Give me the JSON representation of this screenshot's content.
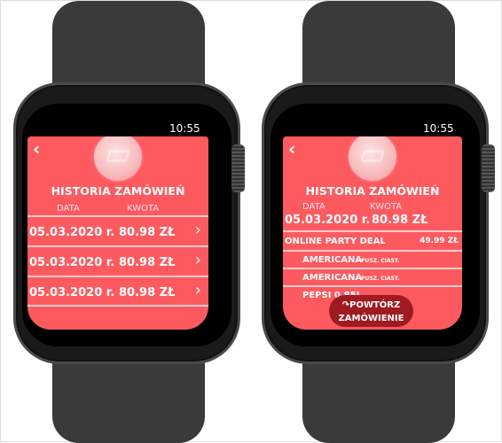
{
  "status_time": "10:55",
  "list_screen": {
    "title": "HISTORIA ZAMÓWIEŃ",
    "col_date": "DATA",
    "col_amount": "KWOTA",
    "orders": [
      {
        "date": "05.03.2020 r.",
        "amount": "80.98 ZŁ"
      },
      {
        "date": "05.03.2020 r.",
        "amount": "80.98 ZŁ"
      },
      {
        "date": "05.03.2020 r.",
        "amount": "80.98 ZŁ"
      }
    ]
  },
  "detail_screen": {
    "title": "HISTORIA ZAMÓWIEŃ",
    "col_date": "DATA",
    "col_amount": "KWOTA",
    "date": "05.03.2020 r.",
    "amount": "80.98 ZŁ",
    "items": [
      {
        "name": "ONLINE PARTY DEAL",
        "price": "49.99 ZŁ",
        "note": ""
      },
      {
        "name": "AMERICANA",
        "note": "PUSZ. CIAST.",
        "price": ""
      },
      {
        "name": "AMERICANA",
        "note": "PUSZ. CIAST.",
        "price": ""
      },
      {
        "name": "PEPSI 0.85L",
        "note": "",
        "price": ""
      }
    ],
    "repeat_line1": "POWTÓRZ",
    "repeat_line2": "ZAMÓWIENIE"
  },
  "colors": {
    "panel": "#fd5a60",
    "button": "#a01a22"
  }
}
